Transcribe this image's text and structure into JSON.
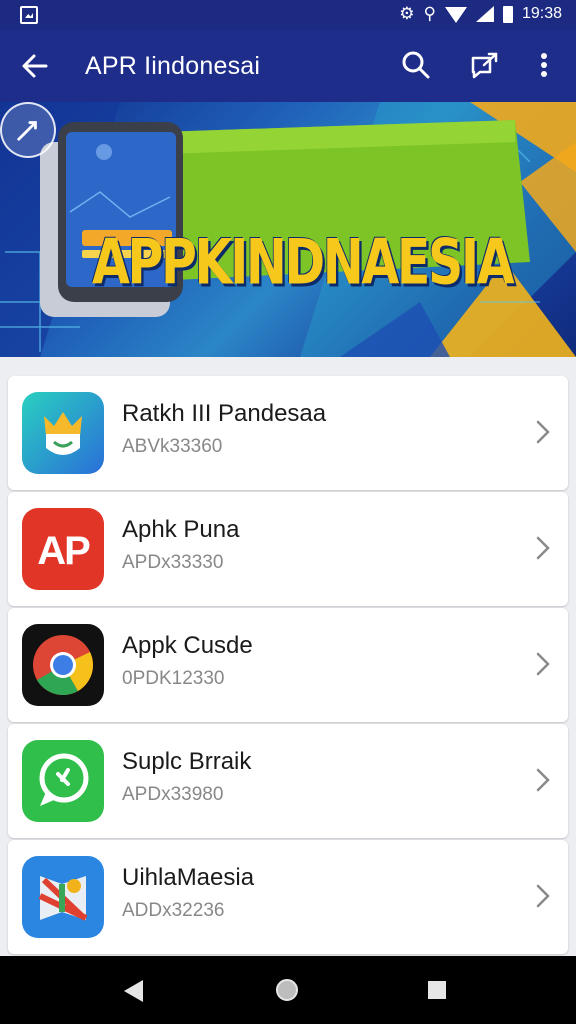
{
  "status_bar": {
    "time": "19:38",
    "icons": [
      "gallery-icon",
      "gear-icon",
      "usb-icon",
      "wifi-icon",
      "signal-icon",
      "battery-icon"
    ]
  },
  "app_bar": {
    "title": "APR Iindonesai",
    "icons": [
      "back-arrow-icon",
      "search-icon",
      "share-icon",
      "more-vert-icon"
    ],
    "color": "#1e2c8a"
  },
  "banner": {
    "headline": "APPKINDNAESIA",
    "pager_count": 5,
    "colors": {
      "accent": "#f7c81c",
      "green": "#7dc427"
    }
  },
  "apps": [
    {
      "name": "Ratkh III Pandesaa",
      "subtitle": "ABVk33360",
      "icon": "crown-app-icon"
    },
    {
      "name": "Aphk Puna",
      "subtitle": "APDx33330",
      "icon": "ap-app-icon"
    },
    {
      "name": "Appk Cusde",
      "subtitle": "0PDK12330",
      "icon": "chrome-app-icon"
    },
    {
      "name": "Suplc Brraik",
      "subtitle": "APDx33980",
      "icon": "chat-app-icon"
    },
    {
      "name": "UihlaMaesia",
      "subtitle": "ADDx32236",
      "icon": "maps-app-icon"
    }
  ],
  "nav_bar": {
    "icons": [
      "nav-back-icon",
      "nav-home-icon",
      "nav-recents-icon"
    ]
  }
}
